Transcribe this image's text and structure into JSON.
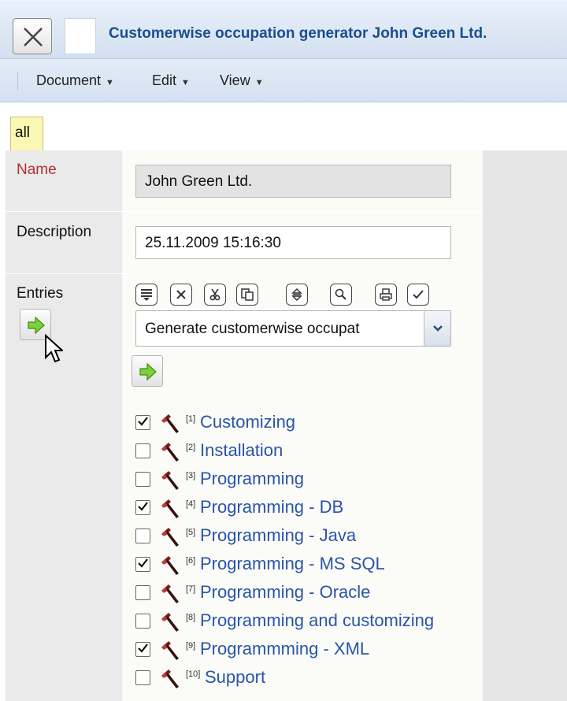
{
  "window": {
    "title": "Customerwise occupation generator John Green Ltd."
  },
  "menu": [
    {
      "label": "Document"
    },
    {
      "label": "Edit"
    },
    {
      "label": "View"
    }
  ],
  "tabs": [
    {
      "label": "all",
      "active": true
    }
  ],
  "form": {
    "name_label": "Name",
    "name_value": "John Green Ltd.",
    "description_label": "Description",
    "description_value": "25.11.2009 15:16:30",
    "entries_label": "Entries"
  },
  "toolbar": {
    "icons": [
      "list-icon",
      "delete-icon",
      "cut-icon",
      "copy-icon",
      "sort-icon",
      "search-icon",
      "print-icon",
      "check-icon"
    ]
  },
  "action_select": {
    "selected": "Generate customerwise occupat"
  },
  "entries": [
    {
      "num": "[1]",
      "label": "Customizing",
      "checked": true
    },
    {
      "num": "[2]",
      "label": "Installation",
      "checked": false
    },
    {
      "num": "[3]",
      "label": "Programming",
      "checked": false
    },
    {
      "num": "[4]",
      "label": "Programming - DB",
      "checked": true
    },
    {
      "num": "[5]",
      "label": "Programming - Java",
      "checked": false
    },
    {
      "num": "[6]",
      "label": "Programming - MS SQL",
      "checked": true
    },
    {
      "num": "[7]",
      "label": "Programming - Oracle",
      "checked": false
    },
    {
      "num": "[8]",
      "label": "Programming and customizing",
      "checked": false
    },
    {
      "num": "[9]",
      "label": "Programmming - XML",
      "checked": true
    },
    {
      "num": "[10]",
      "label": "Support",
      "checked": false
    }
  ],
  "colors": {
    "title_text": "#1b4e8f",
    "link_text": "#2a54a8",
    "tab_bg": "#fbf7b4",
    "required_label": "#b03030",
    "go_arrow": "#7bd13a"
  }
}
